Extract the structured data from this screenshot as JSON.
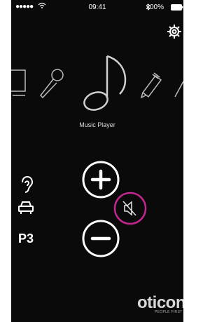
{
  "status_bar": {
    "signal": "●●●●● ",
    "wifi_icon": "wifi-icon",
    "time": "09:41",
    "battery": "100%",
    "bluetooth_icon": "bluetooth-icon"
  },
  "programs": {
    "selected_label": "Music Player",
    "carousel_icons": [
      "tv-icon",
      "microphone-icon",
      "music-note-icon",
      "pen-icon",
      "pen-icon"
    ]
  },
  "side_icons": [
    "ear-icon",
    "car-icon"
  ],
  "program_number": "P3",
  "brand": {
    "name": "oticon",
    "tagline": "PEOPLE FIRST"
  },
  "colors": {
    "background": "#0a0a0a",
    "foreground": "#ffffff",
    "mute_accent": "#c2268f"
  }
}
